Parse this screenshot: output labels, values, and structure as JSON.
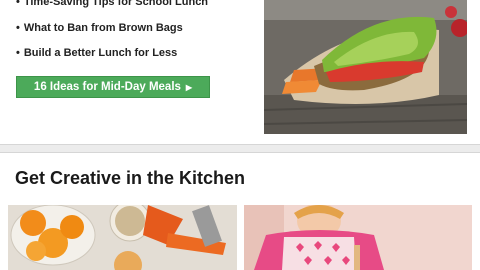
{
  "tips": [
    "Time-Saving Tips for School Lunch",
    "What to Ban from Brown Bags",
    "Build a Better Lunch for Less"
  ],
  "bullet": "•",
  "cta": {
    "label": "16 Ideas for Mid-Day Meals",
    "arrow": "▶"
  },
  "section": {
    "title": "Get Creative in the Kitchen"
  },
  "colors": {
    "accent_green": "#4caa5a",
    "card_bg": "#ffffff",
    "page_bg": "#ececec"
  }
}
